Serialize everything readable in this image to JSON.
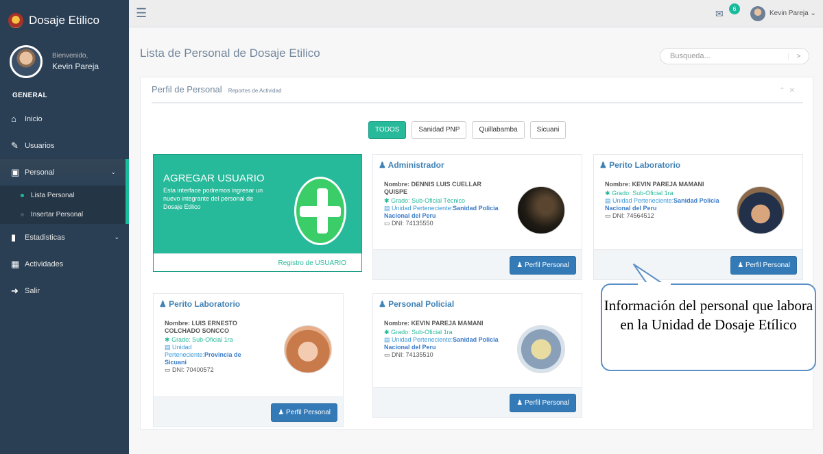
{
  "brand": {
    "title": "Dosaje Etilico"
  },
  "profile": {
    "welcome": "Bienvenido,",
    "name": "Kevin Pareja"
  },
  "sidebar": {
    "section": "GENERAL",
    "items": [
      {
        "label": "Inicio",
        "icon": "home-icon"
      },
      {
        "label": "Usuarios",
        "icon": "edit-icon"
      },
      {
        "label": "Personal",
        "icon": "desktop-icon"
      },
      {
        "label": "Estadisticas",
        "icon": "bar-chart-icon"
      },
      {
        "label": "Actividades",
        "icon": "table-icon"
      },
      {
        "label": "Salir",
        "icon": "sign-out-icon"
      }
    ],
    "subitems": [
      {
        "label": "Lista Personal"
      },
      {
        "label": "Insertar Personal"
      }
    ]
  },
  "topnav": {
    "mail_count": "6",
    "user": "Kevin Pareja"
  },
  "page": {
    "title": "Lista de Personal de Dosaje Etilico"
  },
  "search": {
    "placeholder": "Busqueda...",
    "button": ">"
  },
  "panel": {
    "title": "Perfil de Personal",
    "subtitle": "Reportes de Actividad"
  },
  "filters": [
    "TODOS",
    "Sanidad PNP",
    "Quillabamba",
    "Sicuani"
  ],
  "add_card": {
    "title": "AGREGAR USUARIO",
    "desc": "Esta interface podremos ingresar un nuevo integrante del personal de Dosaje Etilico",
    "footer": "Registro de USUARIO"
  },
  "cards": [
    {
      "role": "Administrador",
      "name": "Nombre: DENNIS LUIS CUELLAR QUISPE",
      "grado": "Grado: Sub-Oficial Técnico",
      "unidad_label": "Unidad Perteneciente:",
      "unidad": "Sanidad Policia Nacional del Peru",
      "dni": "DNI: 74135550",
      "button": "Perfil Personal"
    },
    {
      "role": "Perito Laboratorio",
      "name": "Nombre: KEVIN PAREJA MAMANI",
      "grado": "Grado: Sub-Oficial 1ra",
      "unidad_label": "Unidad Perteneciente:",
      "unidad": "Sanidad Policia Nacional del Peru",
      "dni": "DNI: 74564512",
      "button": "Perfil Personal"
    },
    {
      "role": "Perito Laboratorio",
      "name": "Nombre: LUIS ERNESTO COLCHADO SONCCO",
      "grado": "Grado: Sub-Oficial 1ra",
      "unidad_label": "Unidad Perteneciente:",
      "unidad": "Provincia de Sicuani",
      "dni": "DNI: 70400572",
      "button": "Perfil Personal"
    },
    {
      "role": "Personal Policial",
      "name": "Nombre: KEVIN PAREJA MAMANI",
      "grado": "Grado: Sub-Oficial 1ra",
      "unidad_label": "Unidad Perteneciente:",
      "unidad": "Sanidad Policia Nacional del Peru",
      "dni": "DNI: 74135510",
      "button": "Perfil Personal"
    }
  ],
  "callout": {
    "text": "Información del personal que labora en la Unidad de Dosaje Etílico"
  },
  "colors": {
    "sidebar": "#2a3f54",
    "accent": "#26b99a",
    "primary": "#337ab7",
    "link": "#3f82b5"
  }
}
